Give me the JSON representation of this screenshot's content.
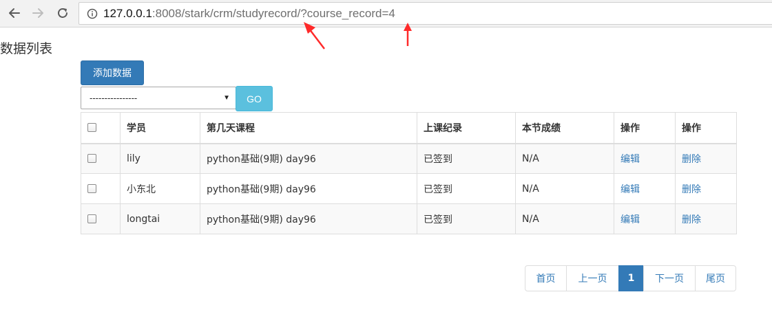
{
  "browser": {
    "url_host": "127.0.0.1",
    "url_rest": ":8008/stark/crm/studyrecord/?course_record=4"
  },
  "page": {
    "title": "数据列表",
    "add_button": "添加数据",
    "action_select": "----------------",
    "go_button": "GO"
  },
  "table": {
    "columns": [
      "学员",
      "第几天课程",
      "上课纪录",
      "本节成绩",
      "操作",
      "操作"
    ],
    "rows": [
      [
        "lily",
        "python基础(9期) day96",
        "已签到",
        "N/A",
        "编辑",
        "删除"
      ],
      [
        "小东北",
        "python基础(9期) day96",
        "已签到",
        "N/A",
        "编辑",
        "删除"
      ],
      [
        "longtai",
        "python基础(9期) day96",
        "已签到",
        "N/A",
        "编辑",
        "删除"
      ]
    ]
  },
  "pagination": {
    "first": "首页",
    "prev": "上一页",
    "current": "1",
    "next": "下一页",
    "last": "尾页"
  },
  "colors": {
    "primary": "#337ab7",
    "info": "#5bc0de",
    "annotation": "#ff2a2a"
  }
}
